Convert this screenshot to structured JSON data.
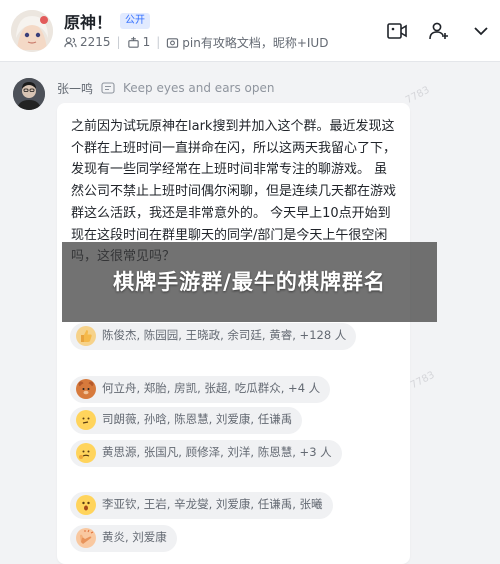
{
  "header": {
    "title": "原神！",
    "badge": "公开",
    "member_count": "2215",
    "admin_count": "1",
    "description": "pin有攻略文档，昵称+IUD",
    "icons": [
      "group-members-icon",
      "admin-icon",
      "doc-icon",
      "video-call-icon",
      "add-member-icon",
      "more-icon"
    ]
  },
  "message": {
    "sender": "张一鸣",
    "status": "Keep eyes and ears open",
    "text": "之前因为试玩原神在lark搜到并加入这个群。最近发现这个群在上班时间一直拼命在闪，所以这两天我留心了下，发现有一些同学经常在上班时间非常专注的聊游戏。 虽然公司不禁止上班时间偶尔闲聊，但是连续几天都在游戏群这么活跃，我还是非常意外的。 今天早上10点开始到现在这段时间在群里聊天的同学/部门是今天上午很空闲吗，这很常见吗？"
  },
  "reactions": [
    {
      "emoji_icon": "thumbs-up-icon",
      "names": "陈俊杰, 陈园园, 王晓政, 余司廷, 黄睿, +128 人"
    },
    {
      "emoji_icon": "bear-face-icon",
      "names": "何立舟, 郑胎, 房凯, 张超, 吃瓜群众, +4 人"
    },
    {
      "emoji_icon": "thinking-face-icon",
      "names": "司朗薇, 孙晗, 陈恩慧, 刘爱康, 任谦禹"
    },
    {
      "emoji_icon": "thinking-face-icon",
      "names": "黄思源, 张国凡, 顾修泽, 刘洋, 陈恩慧, +3 人"
    },
    {
      "emoji_icon": "shocked-face-icon",
      "names": "李亚钦, 王岩, 辛龙燮, 刘爱康, 任谦禹, 张曦"
    },
    {
      "emoji_icon": "clapping-icon",
      "names": "黄炎, 刘爱康"
    }
  ],
  "overlay": {
    "text": "棋牌手游群/最牛的棋牌群名"
  },
  "colors": {
    "accent": "#3370ff",
    "banner_bg": "#3c3c3c",
    "bubble_bg": "#ffffff",
    "page_bg": "#f2f3f5"
  }
}
